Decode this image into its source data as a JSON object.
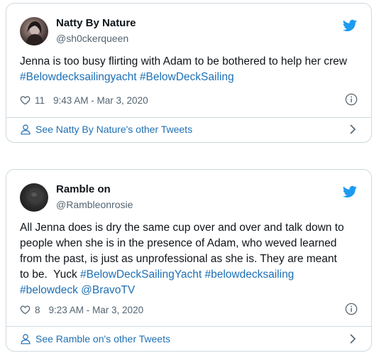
{
  "tweets": [
    {
      "author_name": "Natty By Nature",
      "author_handle": "@sh0ckerqueen",
      "text_plain": "Jenna is too busy flirting with Adam to be bothered to help her crew",
      "hashtags": [
        "#Belowdecksailingyacht",
        "#BelowDeckSailing"
      ],
      "likes": "11",
      "timestamp": "9:43 AM - Mar 3, 2020",
      "other_tweets_link": "See Natty By Nature's other Tweets"
    },
    {
      "author_name": "Ramble on",
      "author_handle": "@Rambleonrosie",
      "text_line1": "All Jenna does is dry the same cup over and over and talk down to",
      "text_line2": "people when she is in the presence of Adam, who weved learned",
      "text_line3": "from the past, is just as unprofessional as she is.  They are meant",
      "text_line4_plain": "to be.  Yuck ",
      "hashtags_line4": "#BelowDeckSailingYacht #belowdecksailing",
      "hashtags_line5": "#belowdeck @BravoTV",
      "likes": "8",
      "timestamp": "9:23 AM - Mar 3, 2020",
      "other_tweets_link": "See Ramble on's other Tweets"
    }
  ],
  "icons": [
    "twitter-bird-icon",
    "heart-icon",
    "info-icon",
    "person-icon",
    "chevron-right-icon"
  ],
  "colors": {
    "link": "#1d6fb5",
    "twitter_blue": "#1d9bf0",
    "secondary_text": "#536471",
    "border": "#cfd9de"
  }
}
